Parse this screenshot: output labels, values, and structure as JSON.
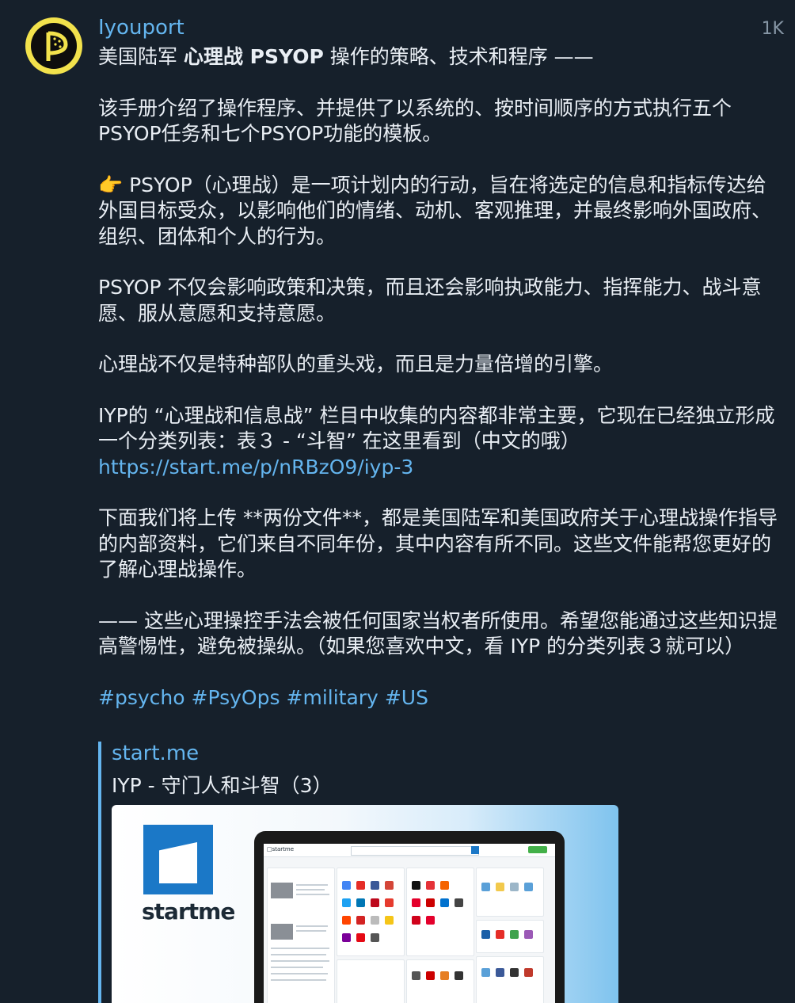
{
  "channel": {
    "name": "Iyouport",
    "views": "1K"
  },
  "post": {
    "headline_prefix": "美国陆军 ",
    "headline_bold": "心理战 PSYOP",
    "headline_suffix": " 操作的策略、技术和程序 ——",
    "p1": "该手册介绍了操作程序、并提供了以系统的、按时间顺序的方式执行五个PSYOP任务和七个PSYOP功能的模板。",
    "p2": "👉 PSYOP（心理战）是一项计划内的行动，旨在将选定的信息和指标传达给外国目标受众，以影响他们的情绪、动机、客观推理，并最终影响外国政府、组织、团体和个人的行为。",
    "p3": "PSYOP 不仅会影响政策和决策，而且还会影响执政能力、指挥能力、战斗意愿、服从意愿和支持意愿。",
    "p4": "心理战不仅是特种部队的重头戏，而且是力量倍增的引擎。",
    "p5_text": "IYP的 “心理战和信息战” 栏目中收集的内容都非常主要，它现在已经独立形成一个分类列表：表３ - “斗智” 在这里看到（中文的哦） ",
    "p5_link": "https://start.me/p/nRBzO9/iyp-3",
    "p6": "下面我们将上传 **两份文件**，都是美国陆军和美国政府关于心理战操作指导的内部资料，它们来自不同年份，其中内容有所不同。这些文件能帮您更好的了解心理战操作。",
    "p7": "—— 这些心理操控手法会被任何国家当权者所使用。希望您能通过这些知识提高警惕性，避免被操纵。（如果您喜欢中文，看 IYP 的分类列表３就可以）",
    "hashtags": [
      "#psycho",
      "#PsyOps",
      "#military",
      "#US"
    ]
  },
  "link_preview": {
    "site": "start.me",
    "title": "IYP - 守门人和斗智（3）",
    "logo_text": "startme",
    "screen_logo": "□startme"
  },
  "colors": {
    "background": "#16202b",
    "link": "#64b5ef",
    "text": "#e9eef4",
    "muted": "#8797a6",
    "avatar_yellow": "#f2e24c"
  },
  "icons": {
    "avatar": "pirate-flag-icon",
    "preview_logo": "startme-logo-icon"
  }
}
